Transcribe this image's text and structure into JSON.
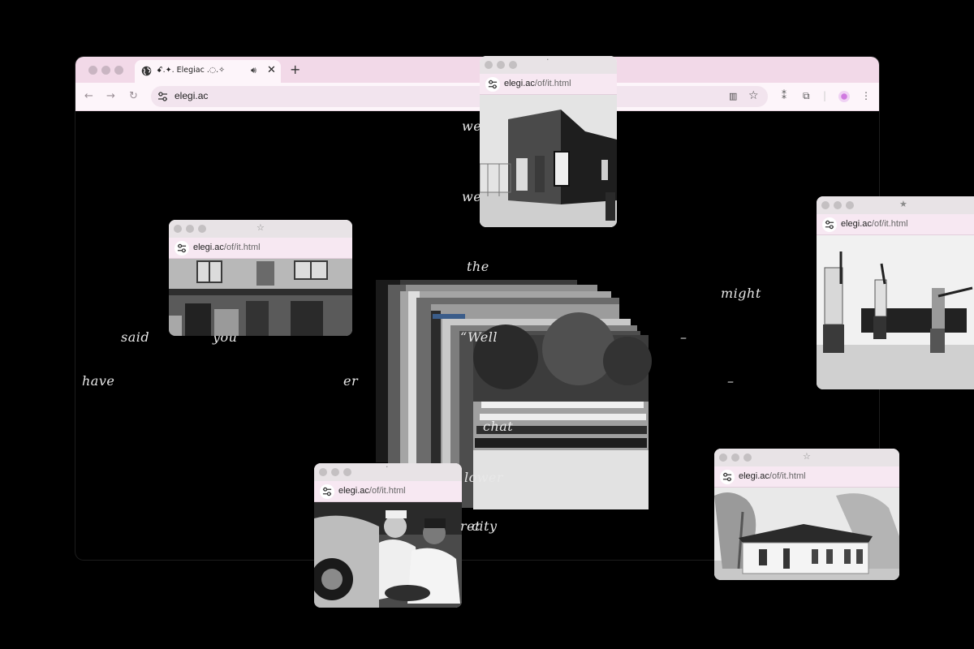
{
  "browser": {
    "tab_title": "ꗃ.✦. Elegiac .◌.✧",
    "tab_audio_icon": "speaker-icon",
    "tab_close_icon": "close-icon",
    "new_tab_icon": "plus-icon",
    "address": "elegi.ac",
    "toolbar_icons": [
      "back-icon",
      "forward-icon",
      "reload-icon",
      "site-settings-icon",
      "reader-icon",
      "bookmark-star-icon",
      "extensions-icon",
      "puzzle-icon",
      "profile-icon",
      "menu-icon"
    ],
    "colors": {
      "chrome": "#f2d9e8",
      "toolbar": "#fdf5fa",
      "page": "#000000"
    }
  },
  "poem": {
    "words": [
      "we",
      "wer",
      "the",
      "might",
      "said",
      "you",
      "“Well",
      "–",
      "have",
      "er",
      "–",
      "chat",
      "lower",
      "ret",
      "city"
    ]
  },
  "popups": [
    {
      "url_host": "elegi.ac",
      "url_path": "/of/it.html",
      "photo": "storefront-photo"
    },
    {
      "url_host": "elegi.ac",
      "url_path": "/of/it.html",
      "photo": "adobe-building-photo"
    },
    {
      "url_host": "elegi.ac",
      "url_path": "/of/it.html",
      "photo": "archery-photo"
    },
    {
      "url_host": "elegi.ac",
      "url_path": "/of/it.html",
      "photo": "men-by-car-photo"
    },
    {
      "url_host": "elegi.ac",
      "url_path": "/of/it.html",
      "photo": "schoolhouse-photo"
    }
  ],
  "stack_photo": "class-portrait-photo"
}
